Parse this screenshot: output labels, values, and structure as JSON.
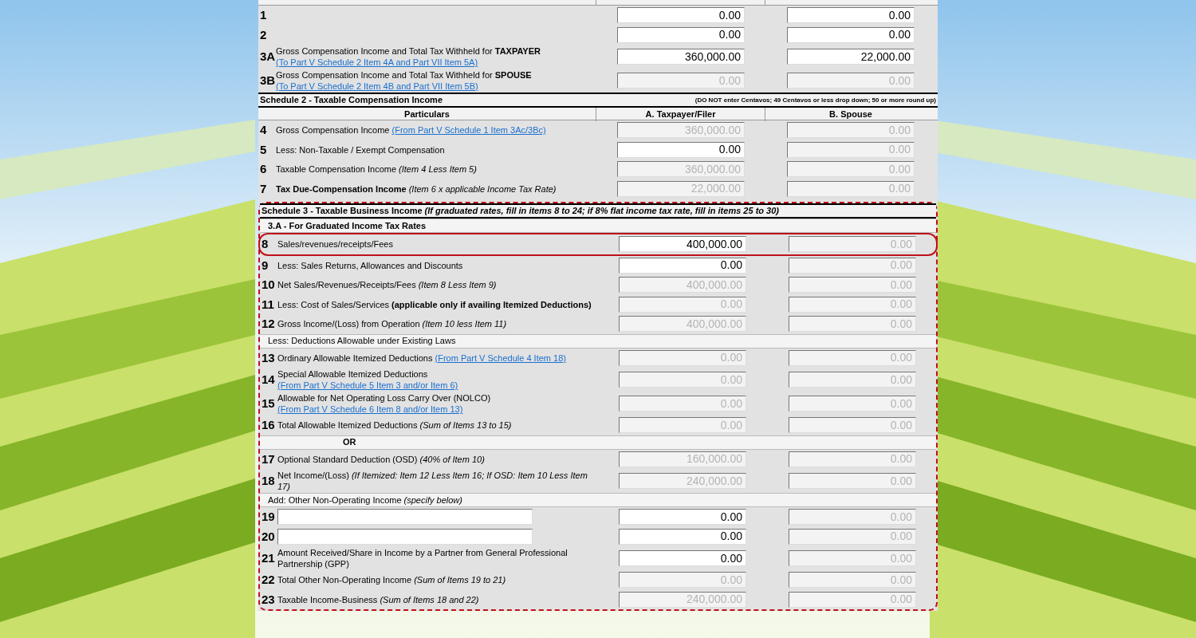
{
  "sections": [
    {
      "blocks": [
        {
          "kind": "column_strip"
        },
        {
          "kind": "row",
          "number": "1",
          "fields": [
            {
              "value": "0.00",
              "disabled": false
            },
            {
              "value": "0.00",
              "disabled": false
            }
          ]
        },
        {
          "kind": "row",
          "number": "2",
          "fields": [
            {
              "value": "0.00",
              "disabled": false
            },
            {
              "value": "0.00",
              "disabled": false
            }
          ]
        },
        {
          "kind": "row",
          "number": "3A",
          "text": "Gross Compensation Income and Total Tax Withheld for **TAXPAYER**",
          "link": "(To Part V Schedule 2 Item 4A and Part VII Item 5A)",
          "fields": [
            {
              "value": "360,000.00",
              "disabled": false
            },
            {
              "value": "22,000.00",
              "disabled": false
            }
          ]
        },
        {
          "kind": "row",
          "number": "3B",
          "text": "Gross Compensation Income and Total Tax Withheld for **SPOUSE**",
          "link": "(To Part V Schedule 2 Item 4B and Part VII Item 5B)",
          "fields": [
            {
              "value": "0.00",
              "disabled": true
            },
            {
              "value": "0.00",
              "disabled": true
            }
          ]
        }
      ]
    },
    {
      "blocks": [
        {
          "kind": "title",
          "text": "Schedule 2 - Taxable Compensation Income",
          "note": "(DO NOT enter Centavos; 49 Centavos or less drop down; 50 or more round up)"
        },
        {
          "kind": "column_header",
          "columns": [
            "Particulars",
            "A. Taxpayer/Filer",
            "B. Spouse"
          ]
        },
        {
          "kind": "row",
          "number": "4",
          "text": "Gross Compensation Income",
          "link": "(From Part V Schedule 1 Item 3Ac/3Bc)",
          "fields": [
            {
              "value": "360,000.00",
              "disabled": true
            },
            {
              "value": "0.00",
              "disabled": true
            }
          ]
        },
        {
          "kind": "row",
          "number": "5",
          "text": "Less: Non-Taxable / Exempt Compensation",
          "fields": [
            {
              "value": "0.00",
              "disabled": false
            },
            {
              "value": "0.00",
              "disabled": true
            }
          ]
        },
        {
          "kind": "row",
          "number": "6",
          "text": "Taxable Compensation Income *(Item 4 Less Item 5)*",
          "fields": [
            {
              "value": "360,000.00",
              "disabled": true
            },
            {
              "value": "0.00",
              "disabled": true
            }
          ]
        },
        {
          "kind": "row",
          "number": "7",
          "text": "**Tax Due-Compensation Income** *(Item 6 x applicable Income Tax Rate)*",
          "fields": [
            {
              "value": "22,000.00",
              "disabled": true
            },
            {
              "value": "0.00",
              "disabled": true
            }
          ]
        }
      ]
    },
    {
      "highlighted": true,
      "blocks": [
        {
          "kind": "title",
          "text": "Schedule 3 - Taxable Business Income *(If graduated rates, fill in items 8 to 24; if 8% flat income tax rate, fill in items 25 to 30)*"
        },
        {
          "kind": "subheader",
          "text": "**3.A - For Graduated Income Tax Rates**"
        },
        {
          "kind": "row",
          "number": "8",
          "highlighted": true,
          "text": "Sales/revenues/receipts/Fees",
          "fields": [
            {
              "value": "400,000.00",
              "disabled": false
            },
            {
              "value": "0.00",
              "disabled": true
            }
          ]
        },
        {
          "kind": "row",
          "number": "9",
          "text": "Less: Sales Returns, Allowances and Discounts",
          "fields": [
            {
              "value": "0.00",
              "disabled": false
            },
            {
              "value": "0.00",
              "disabled": true
            }
          ]
        },
        {
          "kind": "row",
          "number": "10",
          "text": "Net Sales/Revenues/Receipts/Fees *(Item 8 Less Item 9)*",
          "fields": [
            {
              "value": "400,000.00",
              "disabled": true
            },
            {
              "value": "0.00",
              "disabled": true
            }
          ]
        },
        {
          "kind": "row",
          "number": "11",
          "text": "Less: Cost of Sales/Services **(applicable only if availing Itemized Deductions)**",
          "fields": [
            {
              "value": "0.00",
              "disabled": true
            },
            {
              "value": "0.00",
              "disabled": true
            }
          ]
        },
        {
          "kind": "row",
          "number": "12",
          "text": "Gross Income/(Loss) from Operation *(Item 10 less Item 11)*",
          "fields": [
            {
              "value": "400,000.00",
              "disabled": true
            },
            {
              "value": "0.00",
              "disabled": true
            }
          ]
        },
        {
          "kind": "subheader",
          "text": "Less: Deductions Allowable under Existing Laws"
        },
        {
          "kind": "row",
          "number": "13",
          "text": "Ordinary Allowable Itemized Deductions",
          "link": "(From Part V Schedule 4 Item 18)",
          "fields": [
            {
              "value": "0.00",
              "disabled": true
            },
            {
              "value": "0.00",
              "disabled": true
            }
          ]
        },
        {
          "kind": "row",
          "number": "14",
          "text": "Special Allowable Itemized Deductions",
          "link": "(From Part V Schedule 5 Item 3 and/or Item 6)",
          "fields": [
            {
              "value": "0.00",
              "disabled": true
            },
            {
              "value": "0.00",
              "disabled": true
            }
          ]
        },
        {
          "kind": "row",
          "number": "15",
          "text": "Allowable for Net Operating Loss Carry Over (NOLCO)",
          "link": "(From Part V Schedule 6 Item 8 and/or Item 13)",
          "fields": [
            {
              "value": "0.00",
              "disabled": true
            },
            {
              "value": "0.00",
              "disabled": true
            }
          ]
        },
        {
          "kind": "row",
          "number": "16",
          "text": "Total Allowable Itemized Deductions *(Sum of Items 13 to 15)*",
          "fields": [
            {
              "value": "0.00",
              "disabled": true
            },
            {
              "value": "0.00",
              "disabled": true
            }
          ]
        },
        {
          "kind": "or",
          "text": "OR"
        },
        {
          "kind": "row",
          "number": "17",
          "text": "Optional Standard Deduction (OSD) *(40% of Item 10)*",
          "fields": [
            {
              "value": "160,000.00",
              "disabled": true
            },
            {
              "value": "0.00",
              "disabled": true
            }
          ]
        },
        {
          "kind": "row",
          "number": "18",
          "text": "Net Income/(Loss) *(If Itemized: Item 12 Less Item 16; If OSD: Item 10 Less Item 17)*",
          "fields": [
            {
              "value": "240,000.00",
              "disabled": true
            },
            {
              "value": "0.00",
              "disabled": true
            }
          ]
        },
        {
          "kind": "subheader",
          "text": "Add: Other Non-Operating Income *(specify below)*"
        },
        {
          "kind": "specify",
          "number": "19",
          "fields": [
            {
              "value": "0.00",
              "disabled": false
            },
            {
              "value": "0.00",
              "disabled": true
            }
          ]
        },
        {
          "kind": "specify",
          "number": "20",
          "fields": [
            {
              "value": "0.00",
              "disabled": false
            },
            {
              "value": "0.00",
              "disabled": true
            }
          ]
        },
        {
          "kind": "row",
          "number": "21",
          "text": "Amount Received/Share in Income by a Partner from General Professional Partnership (GPP)",
          "fields": [
            {
              "value": "0.00",
              "disabled": false
            },
            {
              "value": "0.00",
              "disabled": true
            }
          ]
        },
        {
          "kind": "row",
          "number": "22",
          "text": "Total Other Non-Operating Income *(Sum of Items 19 to 21)*",
          "fields": [
            {
              "value": "0.00",
              "disabled": true
            },
            {
              "value": "0.00",
              "disabled": true
            }
          ]
        },
        {
          "kind": "row",
          "number": "23",
          "text": "Taxable Income-Business *(Sum of Items 18 and 22)*",
          "fields": [
            {
              "value": "240,000.00",
              "disabled": true
            },
            {
              "value": "0.00",
              "disabled": true
            }
          ]
        }
      ]
    }
  ]
}
